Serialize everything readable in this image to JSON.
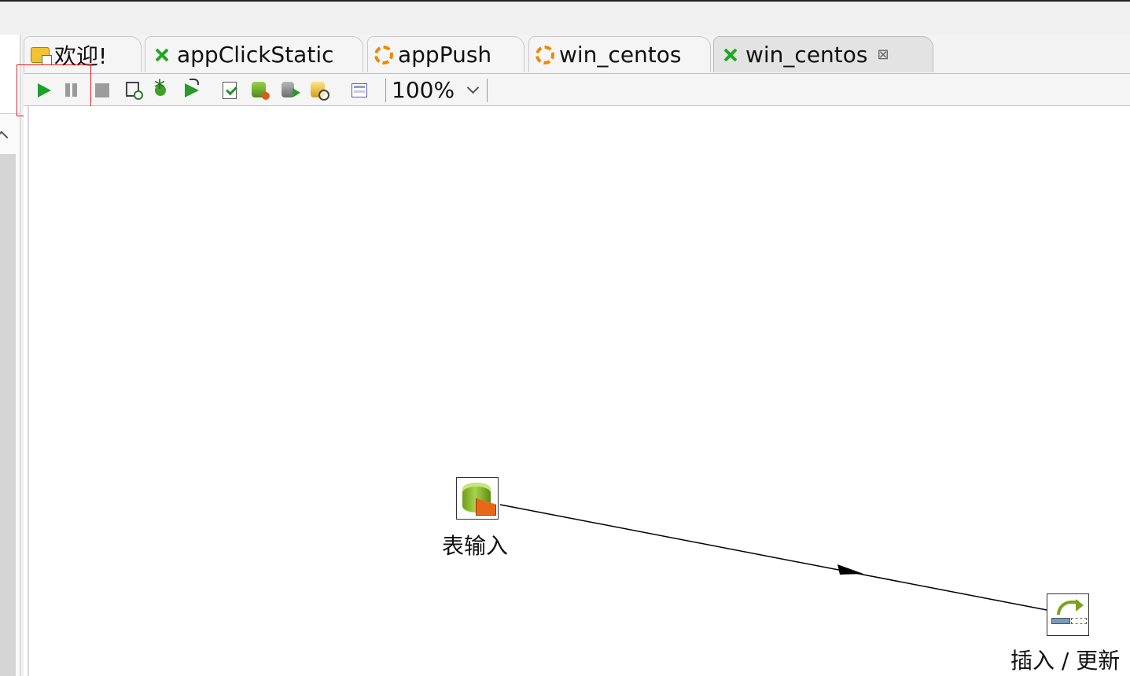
{
  "tabs": [
    {
      "label": "欢迎!",
      "icon": "welcome-icon",
      "active": false
    },
    {
      "label": "appClickStatic",
      "icon": "transformation-icon",
      "active": false
    },
    {
      "label": "appPush",
      "icon": "job-icon",
      "active": false
    },
    {
      "label": "win_centos",
      "icon": "job-icon",
      "active": false
    },
    {
      "label": "win_centos",
      "icon": "transformation-icon",
      "active": true,
      "close": "⊠"
    }
  ],
  "toolbar": {
    "buttons": [
      "run-icon",
      "pause-icon",
      "stop-icon",
      "preview-icon",
      "debug-icon",
      "replay-icon",
      "verify-icon",
      "impact-icon",
      "sql-icon",
      "explore-db-icon",
      "show-results-icon"
    ],
    "zoom": "100%"
  },
  "canvas": {
    "steps": [
      {
        "label": "表输入",
        "icon": "table-input-icon"
      },
      {
        "label": "插入 / 更新",
        "icon": "insert-update-icon"
      }
    ],
    "hop_color": "#000000"
  },
  "colors": {
    "transformation": "#1fa81f",
    "job": "#ee8800",
    "highlight": "#e02020"
  }
}
